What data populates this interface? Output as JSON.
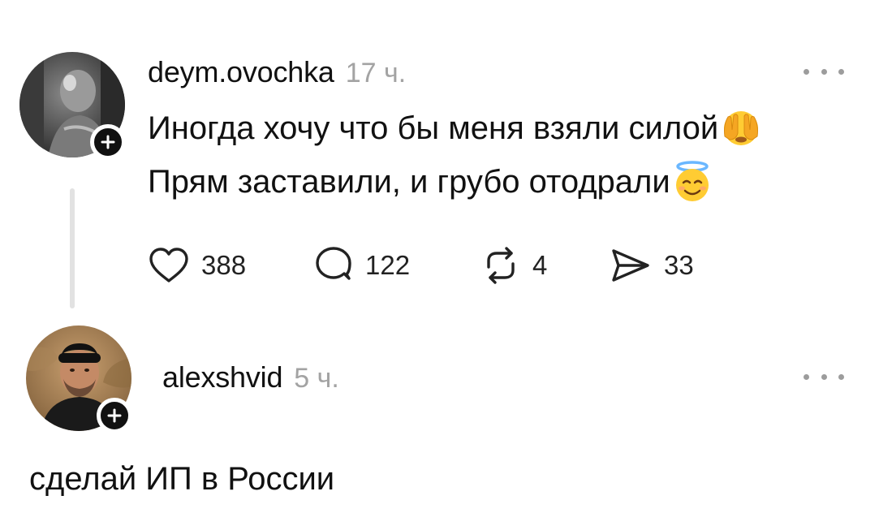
{
  "post": {
    "username": "deym.ovochka",
    "time": "17 ч.",
    "lines": [
      "Иногда хочу что бы меня взяли силой",
      "Прям заставили, и грубо отодрали"
    ],
    "emojis": [
      "hands-covering-face-emoji",
      "smiling-face-with-halo-emoji"
    ],
    "actions": {
      "likes": "388",
      "replies": "122",
      "reposts": "4",
      "shares": "33"
    }
  },
  "reply": {
    "username": "alexshvid",
    "time": "5 ч.",
    "text": "сделай ИП в России"
  },
  "icons": {
    "more": "more-horizontal-icon",
    "follow": "plus-icon",
    "like": "heart-icon",
    "reply": "speech-bubble-icon",
    "repost": "repost-icon",
    "share": "paper-plane-icon"
  }
}
